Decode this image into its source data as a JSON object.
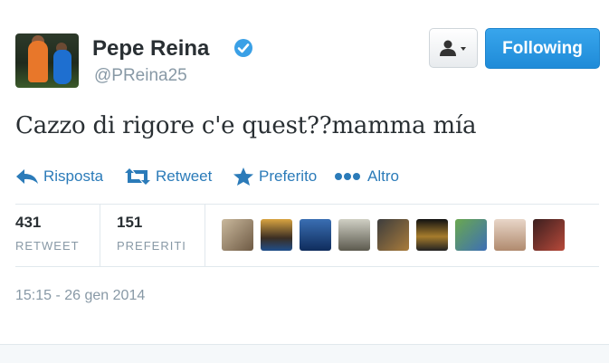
{
  "author": {
    "name": "Pepe Reina",
    "handle": "@PReina25",
    "verified": true
  },
  "buttons": {
    "follow_label": "Following"
  },
  "tweet": {
    "text": "Cazzo di rigore c'e quest??mamma mía",
    "timestamp": "15:15 - 26 gen 2014"
  },
  "actions": [
    {
      "label": "Risposta",
      "icon": "reply-icon"
    },
    {
      "label": "Retweet",
      "icon": "retweet-icon"
    },
    {
      "label": "Preferito",
      "icon": "star-icon"
    },
    {
      "label": "Altro",
      "icon": "more-dots-icon"
    }
  ],
  "stats": {
    "retweets": {
      "value": "431",
      "label": "RETWEET"
    },
    "favorites": {
      "value": "151",
      "label": "PREFERITI"
    }
  },
  "colors": {
    "accent": "#2b7bb9",
    "follow_button": "#2a99e3",
    "text": "#292f33",
    "muted": "#8899a6"
  }
}
